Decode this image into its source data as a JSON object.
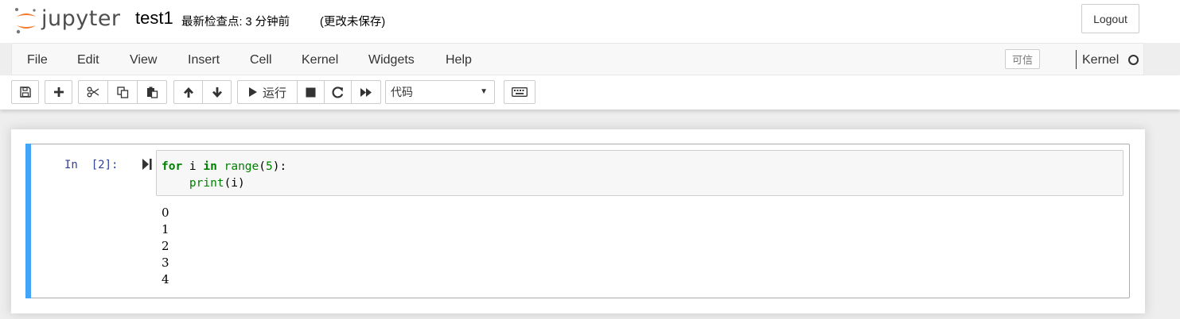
{
  "header": {
    "logo_text": "jupyter",
    "notebook_title": "test1",
    "checkpoint": "最新检查点: 3 分钟前",
    "autosave_status": "(更改未保存)",
    "logout_label": "Logout"
  },
  "menubar": {
    "items": [
      "File",
      "Edit",
      "View",
      "Insert",
      "Cell",
      "Kernel",
      "Widgets",
      "Help"
    ],
    "trusted_label": "可信",
    "kernel_name": "Kernel"
  },
  "toolbar": {
    "run_label": "运行",
    "cell_type_selected": "代码",
    "icons": [
      "save-icon",
      "plus-icon",
      "cut-icon",
      "copy-icon",
      "paste-icon",
      "arrow-up-icon",
      "arrow-down-icon",
      "play-icon",
      "stop-icon",
      "restart-icon",
      "fast-forward-icon",
      "keyboard-icon"
    ]
  },
  "cell": {
    "prompt": "In  [2]:",
    "code_line1": {
      "kw1": "for",
      "var": " i ",
      "kw2": "in",
      "fn": " range",
      "open": "(",
      "num": "5",
      "close": "):"
    },
    "code_line2": {
      "indent": "    ",
      "fn": "print",
      "args": "(i)"
    },
    "output_lines": [
      "0",
      "1",
      "2",
      "3",
      "4"
    ]
  },
  "colors": {
    "selected_cell_bar": "#42a5f5",
    "prompt_color": "#303f9f",
    "keyword_color": "#008000",
    "logo_orange": "#f37726"
  }
}
